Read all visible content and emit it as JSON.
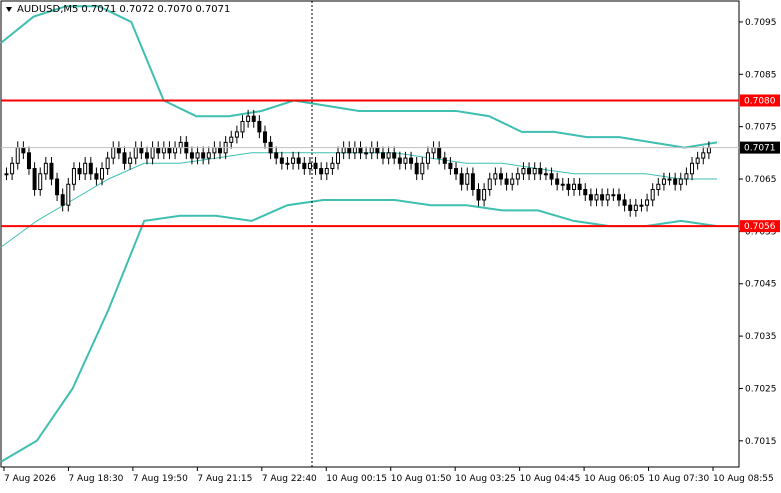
{
  "header": {
    "symbol": "AUDUSD,M5",
    "open": "0.7071",
    "high": "0.7072",
    "low": "0.7070",
    "close": "0.7071"
  },
  "colors": {
    "background": "#ffffff",
    "candles": "#000000",
    "bollinger": "#3fbfb0",
    "level_lines": "#ff0000",
    "crosshair": "#000000"
  },
  "chart_data": {
    "type": "candlestick",
    "symbol": "AUDUSD",
    "timeframe": "M5",
    "ylim": [
      0.701,
      0.7099
    ],
    "y_ticks": [
      "0.7095",
      "0.7085",
      "0.7075",
      "0.7065",
      "0.7055",
      "0.7045",
      "0.7035",
      "0.7025",
      "0.7015"
    ],
    "x_ticks": [
      "7 Aug 2026",
      "7 Aug 18:30",
      "7 Aug 19:50",
      "7 Aug 21:15",
      "7 Aug 22:40",
      "10 Aug 00:15",
      "10 Aug 01:50",
      "10 Aug 03:25",
      "10 Aug 04:45",
      "10 Aug 06:05",
      "10 Aug 07:30",
      "10 Aug 08:55"
    ],
    "horizontal_levels": [
      {
        "label": "0.7080",
        "value": 0.708,
        "color": "#ff0000"
      },
      {
        "label": "0.7056",
        "value": 0.7056,
        "color": "#ff0000"
      }
    ],
    "current_price": {
      "label": "0.7071",
      "value": 0.7071
    },
    "candles_close": [
      0.7066,
      0.7068,
      0.7071,
      0.707,
      0.7067,
      0.7063,
      0.7066,
      0.7068,
      0.7065,
      0.7062,
      0.706,
      0.7064,
      0.7067,
      0.7066,
      0.7068,
      0.7066,
      0.7065,
      0.7067,
      0.7069,
      0.7071,
      0.707,
      0.7068,
      0.7069,
      0.7071,
      0.707,
      0.7069,
      0.7071,
      0.707,
      0.7071,
      0.707,
      0.7071,
      0.7072,
      0.707,
      0.7069,
      0.707,
      0.7069,
      0.707,
      0.7071,
      0.707,
      0.7072,
      0.7073,
      0.7074,
      0.7076,
      0.7077,
      0.7076,
      0.7074,
      0.7072,
      0.707,
      0.7069,
      0.7068,
      0.7068,
      0.7069,
      0.7068,
      0.7067,
      0.7068,
      0.7067,
      0.7066,
      0.7067,
      0.7068,
      0.707,
      0.7071,
      0.707,
      0.7071,
      0.707,
      0.707,
      0.7071,
      0.707,
      0.7069,
      0.707,
      0.7069,
      0.7068,
      0.7069,
      0.7068,
      0.7066,
      0.7068,
      0.707,
      0.7071,
      0.7069,
      0.7068,
      0.7067,
      0.7066,
      0.7064,
      0.7066,
      0.7063,
      0.7061,
      0.7063,
      0.7065,
      0.7066,
      0.7065,
      0.7064,
      0.7065,
      0.7066,
      0.7067,
      0.7066,
      0.7067,
      0.7066,
      0.7066,
      0.7065,
      0.7064,
      0.7064,
      0.7063,
      0.7064,
      0.7063,
      0.7062,
      0.7061,
      0.7062,
      0.7061,
      0.7062,
      0.7062,
      0.7061,
      0.706,
      0.7059,
      0.706,
      0.706,
      0.7061,
      0.7063,
      0.7064,
      0.7065,
      0.7065,
      0.7064,
      0.7065,
      0.7066,
      0.7068,
      0.7069,
      0.707,
      0.7071
    ],
    "bollinger_bands": {
      "period_points": "approximate band values across chart width",
      "upper": [
        0.7091,
        0.7096,
        0.7098,
        0.7098,
        0.7095,
        0.708,
        0.7077,
        0.7077,
        0.7078,
        0.708,
        0.7079,
        0.7078,
        0.7078,
        0.7078,
        0.7078,
        0.7077,
        0.7074,
        0.7074,
        0.7073,
        0.7073,
        0.7072,
        0.7071,
        0.7072
      ],
      "middle": [
        0.7052,
        0.7057,
        0.7061,
        0.7065,
        0.7068,
        0.7068,
        0.7069,
        0.707,
        0.707,
        0.707,
        0.707,
        0.707,
        0.7069,
        0.7068,
        0.7068,
        0.7067,
        0.7066,
        0.7066,
        0.7066,
        0.7065,
        0.7065
      ],
      "lower": [
        0.7011,
        0.7015,
        0.7025,
        0.704,
        0.7057,
        0.7058,
        0.7058,
        0.7057,
        0.706,
        0.7061,
        0.7061,
        0.7061,
        0.706,
        0.706,
        0.7059,
        0.7059,
        0.7057,
        0.7056,
        0.7056,
        0.7057,
        0.7056
      ]
    }
  }
}
